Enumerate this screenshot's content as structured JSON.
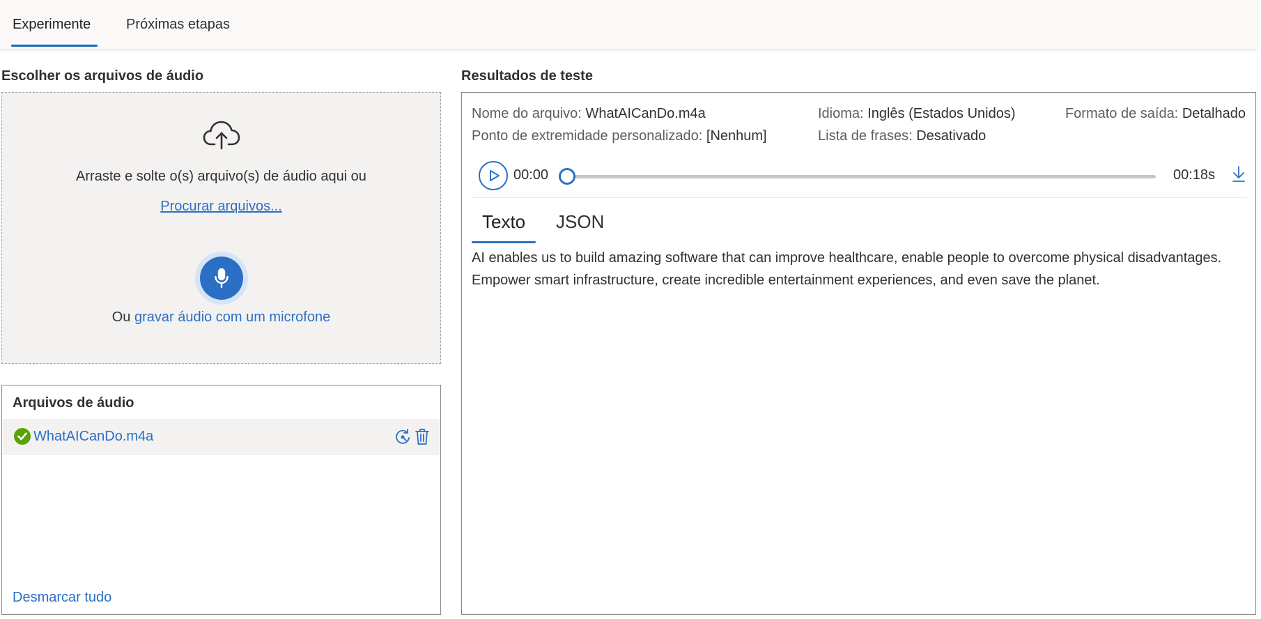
{
  "top_tabs": [
    {
      "label": "Experimente",
      "selected": true
    },
    {
      "label": "Próximas etapas",
      "selected": false
    }
  ],
  "left": {
    "title": "Escolher os arquivos de áudio",
    "dropzone": {
      "icon": "cloud-upload-icon",
      "text": "Arraste e solte o(s) arquivo(s) de áudio aqui ou",
      "browse_link": "Procurar arquivos...",
      "mic_icon": "microphone-icon",
      "or_text": "Ou ",
      "record_link": "gravar áudio com um microfone"
    },
    "files": {
      "title": "Arquivos de áudio",
      "items": [
        {
          "name": "WhatAICanDo.m4a",
          "status": "success",
          "status_color": "#57a300"
        }
      ],
      "unselect_all": "Desmarcar tudo"
    }
  },
  "right": {
    "title": "Resultados de teste",
    "meta": {
      "file_label": "Nome do arquivo:",
      "file_value": "WhatAICanDo.m4a",
      "language_label": "Idioma:",
      "language_value": "Inglês (Estados Unidos)",
      "format_label": "Formato de saída:",
      "format_value": "Detalhado",
      "endpoint_label": "Ponto de extremidade personalizado:",
      "endpoint_value": "[Nenhum]",
      "phrase_label": "Lista de frases:",
      "phrase_value": "Desativado"
    },
    "player": {
      "current_time": "00:00",
      "total_time": "00:18s",
      "progress": 0
    },
    "tabs": [
      {
        "label": "Texto",
        "selected": true
      },
      {
        "label": "JSON",
        "selected": false
      }
    ],
    "transcript": "AI enables us to build amazing software that can improve healthcare, enable people to overcome physical disadvantages. Empower smart infrastructure, create incredible entertainment experiences, and even save the planet."
  },
  "colors": {
    "accent": "#2b6fc4",
    "success": "#57a300"
  }
}
